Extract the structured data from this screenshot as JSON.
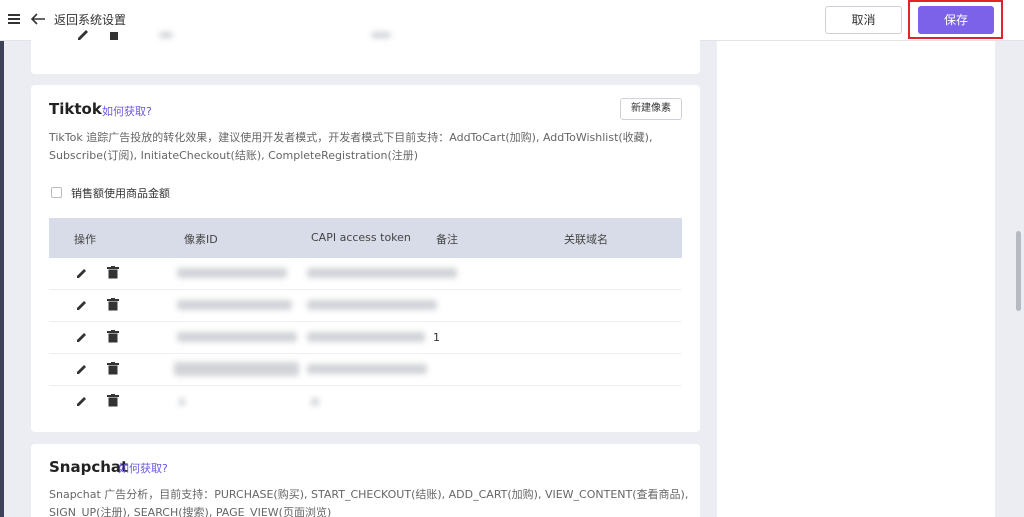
{
  "header": {
    "back_label": "返回系统设置",
    "cancel_label": "取消",
    "save_label": "保存"
  },
  "tiktok": {
    "title": "Tiktok",
    "help_link": "如何获取?",
    "new_pixel_button": "新建像素",
    "description_line1": "TikTok 追踪广告投放的转化效果，建议使用开发者模式，开发者模式下目前支持：AddToCart(加购), AddToWishlist(收藏),",
    "description_line2": "Subscribe(订阅), InitiateCheckout(结账), CompleteRegistration(注册)",
    "checkbox_label": "销售额使用商品金额",
    "columns": [
      "操作",
      "像素ID",
      "CAPI access token",
      "备注",
      "关联域名"
    ],
    "rows": [
      {
        "remark": ""
      },
      {
        "remark": ""
      },
      {
        "remark": "1"
      },
      {
        "remark": ""
      },
      {
        "remark": ""
      }
    ]
  },
  "snapchat": {
    "title": "Snapchat",
    "help_link": "如何获取?",
    "description_line1": "Snapchat 广告分析，目前支持：PURCHASE(购买), START_CHECKOUT(结账), ADD_CART(加购), VIEW_CONTENT(查看商品),",
    "description_line2": "SIGN_UP(注册), SEARCH(搜索), PAGE_VIEW(页面浏览)"
  },
  "colors": {
    "accent": "#7c62e8",
    "highlight": "#e0242b",
    "table_header": "#d8dce8"
  }
}
